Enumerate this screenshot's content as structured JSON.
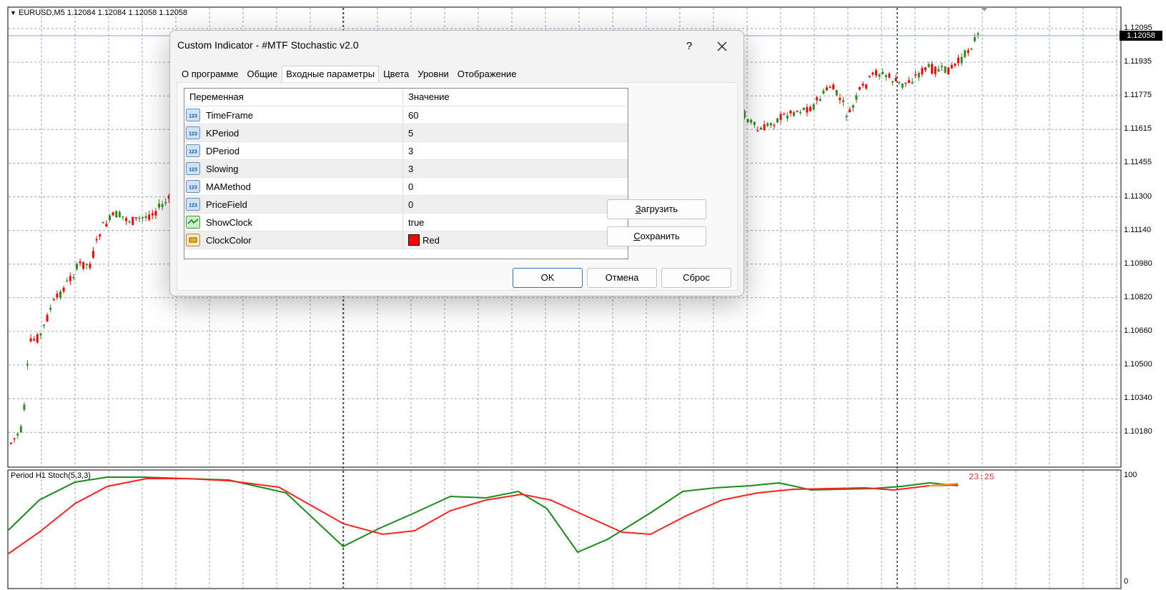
{
  "chart": {
    "header": "EURUSD,M5  1.12084 1.12084 1.12058 1.12058",
    "current_price": "1.12058",
    "price_ticks": [
      "1.12095",
      "1.11935",
      "1.11775",
      "1.11615",
      "1.11455",
      "1.11300",
      "1.11140",
      "1.10980",
      "1.10820",
      "1.10660",
      "1.10500",
      "1.10340",
      "1.10180"
    ],
    "indicator_label": "Period H1 Stoch(5,3,3)",
    "indicator_ticks": [
      "100",
      "0"
    ],
    "clock": "23:25",
    "colors": {
      "bull": "#2e8b1e",
      "bear": "#ff0000",
      "main_line": "#1a8a1a",
      "signal_line": "#ff2020",
      "grid": "#9aa6b8"
    }
  },
  "dialog": {
    "title": "Custom Indicator - #MTF Stochastic v2.0",
    "help": "?",
    "close": "✕",
    "tabs": [
      "О программе",
      "Общие",
      "Входные параметры",
      "Цвета",
      "Уровни",
      "Отображение"
    ],
    "active_tab": "Входные параметры",
    "table": {
      "headers": [
        "Переменная",
        "Значение"
      ],
      "rows": [
        {
          "name": "TimeFrame",
          "value": "60",
          "icon": "number-icon"
        },
        {
          "name": "KPeriod",
          "value": "5",
          "icon": "number-icon"
        },
        {
          "name": "DPeriod",
          "value": "3",
          "icon": "number-icon"
        },
        {
          "name": "Slowing",
          "value": "3",
          "icon": "number-icon"
        },
        {
          "name": "MAMethod",
          "value": "0",
          "icon": "number-icon"
        },
        {
          "name": "PriceField",
          "value": "0",
          "icon": "number-icon"
        },
        {
          "name": "ShowClock",
          "value": "true",
          "icon": "boolean-icon"
        },
        {
          "name": "ClockColor",
          "value": "Red",
          "icon": "color-icon",
          "swatch": "#ff0000"
        }
      ]
    },
    "load_first": "З",
    "load_rest": "агрузить",
    "save_first": "С",
    "save_rest": "охранить",
    "ok": "OK",
    "cancel": "Отмена",
    "reset": "Сброс"
  }
}
